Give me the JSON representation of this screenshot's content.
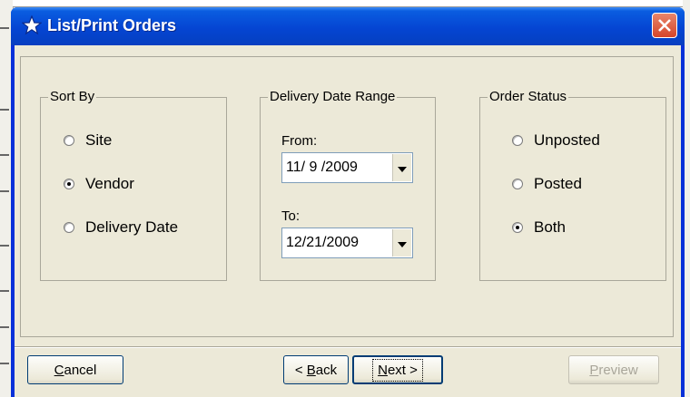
{
  "window": {
    "title": "List/Print Orders",
    "title_icon": "star-icon",
    "close_icon": "close-icon"
  },
  "sort_by": {
    "legend": "Sort By",
    "options": [
      {
        "label": "Site",
        "checked": false
      },
      {
        "label": "Vendor",
        "checked": true
      },
      {
        "label": "Delivery Date",
        "checked": false
      }
    ]
  },
  "date_range": {
    "legend": "Delivery Date Range",
    "from_label": "From:",
    "from_value": "11/ 9 /2009",
    "to_label": "To:",
    "to_value": "12/21/2009"
  },
  "order_status": {
    "legend": "Order Status",
    "options": [
      {
        "label": "Unposted",
        "checked": false
      },
      {
        "label": "Posted",
        "checked": false
      },
      {
        "label": "Both",
        "checked": true
      }
    ]
  },
  "buttons": {
    "cancel": {
      "mnemonic": "C",
      "rest": "ancel"
    },
    "back": {
      "prefix": "< ",
      "mnemonic": "B",
      "rest": "ack"
    },
    "next": {
      "mnemonic": "N",
      "rest": "ext >"
    },
    "preview": {
      "mnemonic": "P",
      "rest": "review"
    }
  },
  "colors": {
    "titlebar": "#0545d3",
    "client": "#ece9d8",
    "close": "#d6452a"
  }
}
